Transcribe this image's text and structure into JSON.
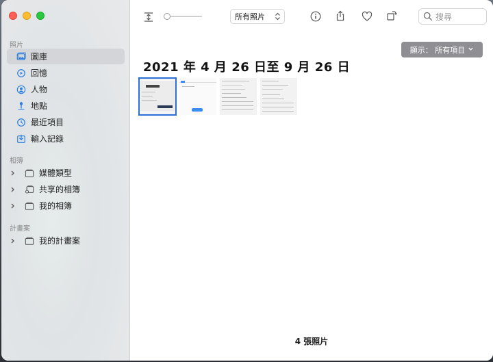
{
  "sidebar": {
    "photos_section": "照片",
    "library_items": [
      {
        "label": "圖庫",
        "icon": "photo-library-icon"
      },
      {
        "label": "回憶",
        "icon": "memories-icon"
      },
      {
        "label": "人物",
        "icon": "people-icon"
      },
      {
        "label": "地點",
        "icon": "places-icon"
      },
      {
        "label": "最近項目",
        "icon": "recents-icon"
      },
      {
        "label": "輸入記錄",
        "icon": "imports-icon"
      }
    ],
    "albums_section": "相簿",
    "album_items": [
      {
        "label": "媒體類型",
        "icon": "folder-icon"
      },
      {
        "label": "共享的相簿",
        "icon": "shared-album-icon"
      },
      {
        "label": "我的相簿",
        "icon": "folder-icon"
      }
    ],
    "projects_section": "計畫案",
    "project_items": [
      {
        "label": "我的計畫案",
        "icon": "folder-icon"
      }
    ]
  },
  "toolbar": {
    "view_select": "所有照片",
    "search_placeholder": "搜尋",
    "zoom_level": 0.0
  },
  "main": {
    "show_button": "顯示：  所有項目",
    "date_range": "2021 年 4 月 26 日至 9 月 26 日",
    "photo_count": "4 張照片"
  },
  "colors": {
    "accent": "#2a7de1",
    "selection_border": "#2a6fd8",
    "show_button_bg": "#8e8e93"
  }
}
